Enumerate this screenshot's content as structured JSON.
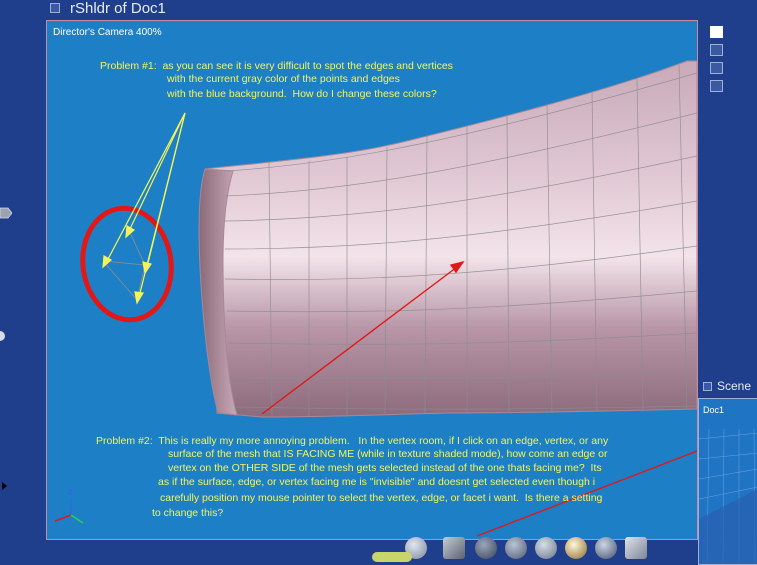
{
  "window": {
    "title": "rShldr of Doc1"
  },
  "viewport": {
    "camera_label": "Director's Camera 400%"
  },
  "annotations": {
    "problem1_lines": [
      "Problem #1:  as you can see it is very difficult to spot the edges and vertices",
      "with the current gray color of the points and edges",
      "with the blue background.  How do I change these colors?"
    ],
    "problem2_lines": [
      "Problem #2:  This is really my more annoying problem.   In the vertex room, if I click on an edge, vertex, or any",
      "surface of the mesh that IS FACING ME (while in texture shaded mode), how come an edge or",
      "vertex on the OTHER SIDE of the mesh gets selected instead of the one thats facing me?  Its",
      "as if the surface, edge, or vertex facing me is \"invisible\" and doesnt get selected even though i",
      "carefully position my mouse pointer to select the vertex, edge, or facet i want.  Is there a setting",
      "to change this?"
    ]
  },
  "scene_panel": {
    "title": "Scene",
    "doc_label": "Doc1"
  },
  "axis": {
    "z": "z"
  },
  "colors": {
    "background": "#1f3f8c",
    "viewport_bg": "#1d80c7",
    "annotation_yellow": "#f4f45a",
    "annotation_red": "#e01818",
    "mesh_pink": "#d9b9c8"
  },
  "toolbar_icons": [
    "up-arrow-icon",
    "cube-icon",
    "wire-sphere-icon",
    "grid-sphere-icon",
    "shaded-sphere-icon",
    "gold-sphere-icon",
    "textured-sphere-icon",
    "box-icon"
  ],
  "side_icons": [
    "single-view-icon",
    "two-view-icon",
    "four-view-icon",
    "split-view-icon"
  ]
}
